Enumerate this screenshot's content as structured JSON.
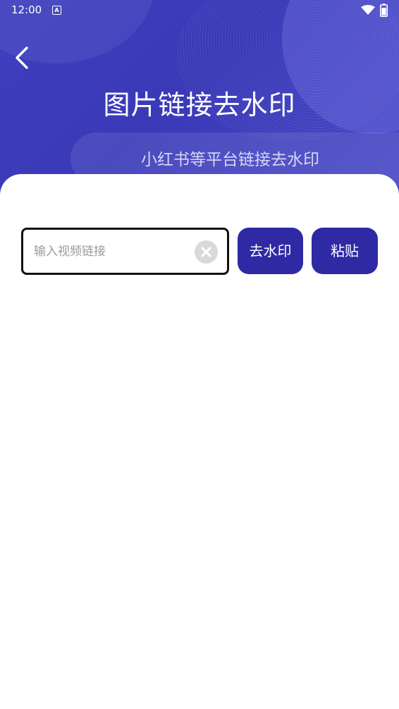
{
  "status_bar": {
    "time": "12:00",
    "notification_icon": "a-letter-icon",
    "wifi_icon": "wifi-icon",
    "battery_icon": "battery-icon"
  },
  "header": {
    "back_icon": "chevron-left-icon",
    "title": "图片链接去水印",
    "subtitle": "小红书等平台链接去水印"
  },
  "form": {
    "input_value": "",
    "input_placeholder": "输入视频链接",
    "clear_icon": "close-circle-icon",
    "remove_watermark_label": "去水印",
    "paste_label": "粘贴"
  },
  "colors": {
    "header_bg": "#3b3bba",
    "button_bg": "#2f2aa3",
    "clear_bg": "#d9d9d9"
  }
}
